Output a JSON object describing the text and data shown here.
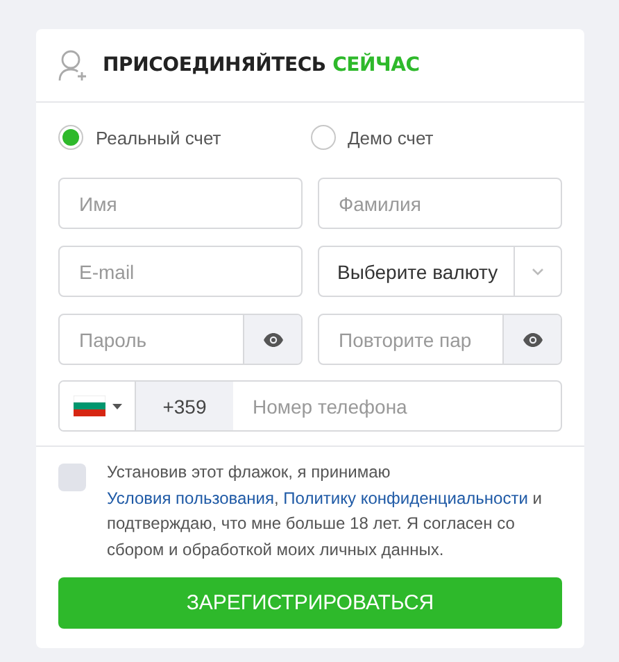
{
  "heading": {
    "text": "ПРИСОЕДИНЯЙТЕСЬ",
    "highlight": "СЕЙЧАС"
  },
  "account_types": [
    {
      "label": "Реальный счет",
      "selected": true
    },
    {
      "label": "Демо счет",
      "selected": false
    }
  ],
  "fields": [
    {
      "kind": "text",
      "placeholder": "Имя"
    },
    {
      "kind": "text",
      "placeholder": "Фамилия"
    },
    {
      "kind": "text",
      "placeholder": "E-mail"
    },
    {
      "kind": "select",
      "value": "Выберите валюту"
    },
    {
      "kind": "password",
      "placeholder": "Пароль"
    },
    {
      "kind": "password",
      "placeholder": "Повторите пар"
    }
  ],
  "phone": {
    "code": "+359",
    "placeholder": "Номер телефона"
  },
  "consent": {
    "checked": false,
    "parts": [
      {
        "kind": "text",
        "text": "Установив этот флажок, я принимаю "
      },
      {
        "kind": "link",
        "text": "Условия пользования"
      },
      {
        "kind": "text",
        "text": ", "
      },
      {
        "kind": "link",
        "text": "Политику конфиденциальности"
      },
      {
        "kind": "text",
        "text": " и подтверждаю, что мне больше 18 лет. Я согласен со сбором и обработкой моих личных данных."
      }
    ]
  },
  "submit": "ЗАРЕГИСТРИРОВАТЬСЯ"
}
